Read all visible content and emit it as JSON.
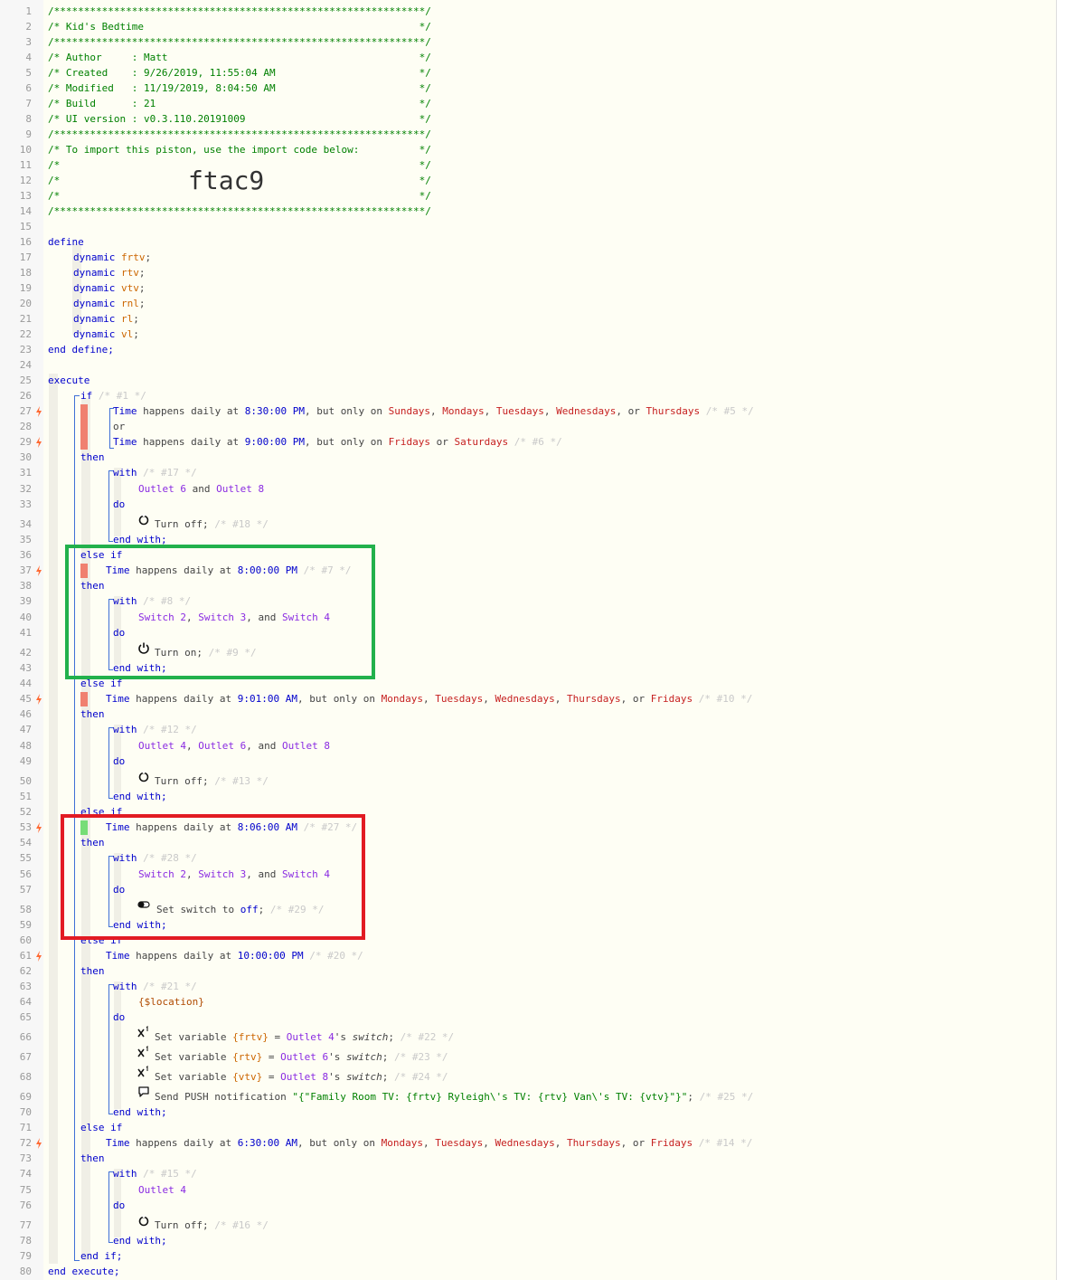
{
  "colors": {
    "keyword": "#0000cc",
    "comment": "#008000",
    "dim_comment": "#c9c9c9",
    "time": "#c62020",
    "device": "#8a2be2",
    "variable": "#cc6600",
    "bolt": "#ff6a33",
    "bar_red": "#f08070",
    "bar_green": "#77dd77",
    "frame_green": "#22b14c",
    "frame_red": "#e21b23"
  },
  "import_code": "ftac9",
  "line_numbers": [
    "1",
    "2",
    "3",
    "4",
    "5",
    "6",
    "7",
    "8",
    "9",
    "10",
    "11",
    "12",
    "13",
    "14",
    "15",
    "16",
    "17",
    "18",
    "19",
    "20",
    "21",
    "22",
    "23",
    "24",
    "25",
    "26",
    "27",
    "28",
    "29",
    "30",
    "31",
    "32",
    "33",
    "34",
    "35",
    "36",
    "37",
    "38",
    "39",
    "40",
    "41",
    "42",
    "43",
    "44",
    "45",
    "46",
    "47",
    "48",
    "49",
    "50",
    "51",
    "52",
    "53",
    "54",
    "55",
    "56",
    "57",
    "58",
    "59",
    "60",
    "61",
    "62",
    "63",
    "64",
    "65",
    "66",
    "67",
    "68",
    "69",
    "70",
    "71",
    "72",
    "73",
    "74",
    "75",
    "76",
    "77",
    "78",
    "79",
    "80"
  ],
  "lines": [
    [
      {
        "t": "/**************************************************************/",
        "c": "cm"
      }
    ],
    [
      {
        "t": "/* Kid's Bedtime                                              */",
        "c": "cm"
      }
    ],
    [
      {
        "t": "/**************************************************************/",
        "c": "cm"
      }
    ],
    [
      {
        "t": "/* Author     : Matt                                          */",
        "c": "cm"
      }
    ],
    [
      {
        "t": "/* Created    : 9/26/2019, 11:55:04 AM                        */",
        "c": "cm"
      }
    ],
    [
      {
        "t": "/* Modified   : 11/19/2019, 8:04:50 AM                        */",
        "c": "cm"
      }
    ],
    [
      {
        "t": "/* Build      : 21                                            */",
        "c": "cm"
      }
    ],
    [
      {
        "t": "/* UI version : v0.3.110.20191009                             */",
        "c": "cm"
      }
    ],
    [
      {
        "t": "/**************************************************************/",
        "c": "cm"
      }
    ],
    [
      {
        "t": "/* To import this piston, use the import code below:          */",
        "c": "cm"
      }
    ],
    [
      {
        "t": "/*                                                            */",
        "c": "cm"
      }
    ],
    [
      {
        "t": "/*                                                            */",
        "c": "cm"
      }
    ],
    [
      {
        "t": "/*                                                            */",
        "c": "cm"
      }
    ],
    [
      {
        "t": "/**************************************************************/",
        "c": "cm"
      }
    ],
    [],
    [
      {
        "t": "define",
        "c": "kw"
      }
    ],
    [
      {
        "t": "dynamic",
        "c": "kw"
      },
      {
        "t": " "
      },
      {
        "t": "frtv",
        "c": "or"
      },
      {
        "t": ";",
        "c": "dk"
      }
    ],
    [
      {
        "t": "dynamic",
        "c": "kw"
      },
      {
        "t": " "
      },
      {
        "t": "rtv",
        "c": "or"
      },
      {
        "t": ";",
        "c": "dk"
      }
    ],
    [
      {
        "t": "dynamic",
        "c": "kw"
      },
      {
        "t": " "
      },
      {
        "t": "vtv",
        "c": "or"
      },
      {
        "t": ";",
        "c": "dk"
      }
    ],
    [
      {
        "t": "dynamic",
        "c": "kw"
      },
      {
        "t": " "
      },
      {
        "t": "rnl",
        "c": "or"
      },
      {
        "t": ";",
        "c": "dk"
      }
    ],
    [
      {
        "t": "dynamic",
        "c": "kw"
      },
      {
        "t": " "
      },
      {
        "t": "rl",
        "c": "or"
      },
      {
        "t": ";",
        "c": "dk"
      }
    ],
    [
      {
        "t": "dynamic",
        "c": "kw"
      },
      {
        "t": " "
      },
      {
        "t": "vl",
        "c": "or"
      },
      {
        "t": ";",
        "c": "dk"
      }
    ],
    [
      {
        "t": "end define;",
        "c": "kw"
      }
    ],
    [],
    [
      {
        "t": "execute",
        "c": "kw"
      }
    ],
    [
      {
        "t": "if",
        "c": "kw"
      },
      {
        "t": " /* #1 */",
        "c": "cmm"
      }
    ],
    [
      {
        "t": "Time",
        "c": "kw"
      },
      {
        "t": " happens daily at ",
        "c": "dk"
      },
      {
        "t": "8:30:00 PM",
        "c": "kw"
      },
      {
        "t": ", but only on ",
        "c": "dk"
      },
      {
        "t": "Sundays",
        "c": "rd"
      },
      {
        "t": ", ",
        "c": "dk"
      },
      {
        "t": "Mondays",
        "c": "rd"
      },
      {
        "t": ", ",
        "c": "dk"
      },
      {
        "t": "Tuesdays",
        "c": "rd"
      },
      {
        "t": ", ",
        "c": "dk"
      },
      {
        "t": "Wednesdays",
        "c": "rd"
      },
      {
        "t": ", or ",
        "c": "dk"
      },
      {
        "t": "Thursdays",
        "c": "rd"
      },
      {
        "t": " /* #5 */",
        "c": "cmm"
      }
    ],
    [
      {
        "t": "or",
        "c": "dk"
      }
    ],
    [
      {
        "t": "Time",
        "c": "kw"
      },
      {
        "t": " happens daily at ",
        "c": "dk"
      },
      {
        "t": "9:00:00 PM",
        "c": "kw"
      },
      {
        "t": ", but only on ",
        "c": "dk"
      },
      {
        "t": "Fridays",
        "c": "rd"
      },
      {
        "t": " or ",
        "c": "dk"
      },
      {
        "t": "Saturdays",
        "c": "rd"
      },
      {
        "t": " /* #6 */",
        "c": "cmm"
      }
    ],
    [
      {
        "t": "then",
        "c": "kw"
      }
    ],
    [
      {
        "t": "with",
        "c": "kw"
      },
      {
        "t": " /* #17 */",
        "c": "cmm"
      }
    ],
    [
      {
        "t": "Outlet 6",
        "c": "pu"
      },
      {
        "t": " and ",
        "c": "dk"
      },
      {
        "t": "Outlet 8",
        "c": "pu"
      }
    ],
    [
      {
        "t": "do",
        "c": "kw"
      }
    ],
    [
      {
        "t": "Turn off;",
        "c": "dk"
      },
      {
        "t": " /* #18 */",
        "c": "cmm"
      }
    ],
    [
      {
        "t": "end with;",
        "c": "kw"
      }
    ],
    [
      {
        "t": "else if",
        "c": "kw"
      }
    ],
    [
      {
        "t": "Time",
        "c": "kw"
      },
      {
        "t": " happens daily at ",
        "c": "dk"
      },
      {
        "t": "8:00:00 PM",
        "c": "kw"
      },
      {
        "t": " /* #7 */",
        "c": "cmm"
      }
    ],
    [
      {
        "t": "then",
        "c": "kw"
      }
    ],
    [
      {
        "t": "with",
        "c": "kw"
      },
      {
        "t": " /* #8 */",
        "c": "cmm"
      }
    ],
    [
      {
        "t": "Switch 2",
        "c": "pu"
      },
      {
        "t": ", ",
        "c": "dk"
      },
      {
        "t": "Switch 3",
        "c": "pu"
      },
      {
        "t": ", and ",
        "c": "dk"
      },
      {
        "t": "Switch 4",
        "c": "pu"
      }
    ],
    [
      {
        "t": "do",
        "c": "kw"
      }
    ],
    [
      {
        "t": "Turn on;",
        "c": "dk"
      },
      {
        "t": " /* #9 */",
        "c": "cmm"
      }
    ],
    [
      {
        "t": "end with;",
        "c": "kw"
      }
    ],
    [
      {
        "t": "else if",
        "c": "kw"
      }
    ],
    [
      {
        "t": "Time",
        "c": "kw"
      },
      {
        "t": " happens daily at ",
        "c": "dk"
      },
      {
        "t": "9:01:00 AM",
        "c": "kw"
      },
      {
        "t": ", but only on ",
        "c": "dk"
      },
      {
        "t": "Mondays",
        "c": "rd"
      },
      {
        "t": ", ",
        "c": "dk"
      },
      {
        "t": "Tuesdays",
        "c": "rd"
      },
      {
        "t": ", ",
        "c": "dk"
      },
      {
        "t": "Wednesdays",
        "c": "rd"
      },
      {
        "t": ", ",
        "c": "dk"
      },
      {
        "t": "Thursdays",
        "c": "rd"
      },
      {
        "t": ", or ",
        "c": "dk"
      },
      {
        "t": "Fridays",
        "c": "rd"
      },
      {
        "t": " /* #10 */",
        "c": "cmm"
      }
    ],
    [
      {
        "t": "then",
        "c": "kw"
      }
    ],
    [
      {
        "t": "with",
        "c": "kw"
      },
      {
        "t": " /* #12 */",
        "c": "cmm"
      }
    ],
    [
      {
        "t": "Outlet 4",
        "c": "pu"
      },
      {
        "t": ", ",
        "c": "dk"
      },
      {
        "t": "Outlet 6",
        "c": "pu"
      },
      {
        "t": ", and ",
        "c": "dk"
      },
      {
        "t": "Outlet 8",
        "c": "pu"
      }
    ],
    [
      {
        "t": "do",
        "c": "kw"
      }
    ],
    [
      {
        "t": "Turn off;",
        "c": "dk"
      },
      {
        "t": " /* #13 */",
        "c": "cmm"
      }
    ],
    [
      {
        "t": "end with;",
        "c": "kw"
      }
    ],
    [
      {
        "t": "else if",
        "c": "kw"
      }
    ],
    [
      {
        "t": "Time",
        "c": "kw"
      },
      {
        "t": " happens daily at ",
        "c": "dk"
      },
      {
        "t": "8:06:00 AM",
        "c": "kw"
      },
      {
        "t": " /* #27 */",
        "c": "cmm"
      }
    ],
    [
      {
        "t": "then",
        "c": "kw"
      }
    ],
    [
      {
        "t": "with",
        "c": "kw"
      },
      {
        "t": " /* #28 */",
        "c": "cmm"
      }
    ],
    [
      {
        "t": "Switch 2",
        "c": "pu"
      },
      {
        "t": ", ",
        "c": "dk"
      },
      {
        "t": "Switch 3",
        "c": "pu"
      },
      {
        "t": ", and ",
        "c": "dk"
      },
      {
        "t": "Switch 4",
        "c": "pu"
      }
    ],
    [
      {
        "t": "do",
        "c": "kw"
      }
    ],
    [
      {
        "t": "Set switch to ",
        "c": "dk"
      },
      {
        "t": "off",
        "c": "kw"
      },
      {
        "t": ";",
        "c": "dk"
      },
      {
        "t": " /* #29 */",
        "c": "cmm"
      }
    ],
    [
      {
        "t": "end with;",
        "c": "kw"
      }
    ],
    [
      {
        "t": "else if",
        "c": "kw"
      }
    ],
    [
      {
        "t": "Time",
        "c": "kw"
      },
      {
        "t": " happens daily at ",
        "c": "dk"
      },
      {
        "t": "10:00:00 PM",
        "c": "kw"
      },
      {
        "t": " /* #20 */",
        "c": "cmm"
      }
    ],
    [
      {
        "t": "then",
        "c": "kw"
      }
    ],
    [
      {
        "t": "with",
        "c": "kw"
      },
      {
        "t": " /* #21 */",
        "c": "cmm"
      }
    ],
    [
      {
        "t": "{$location}",
        "c": "bw"
      }
    ],
    [
      {
        "t": "do",
        "c": "kw"
      }
    ],
    [
      {
        "t": "Set variable ",
        "c": "dk"
      },
      {
        "t": "{frtv}",
        "c": "or"
      },
      {
        "t": " = ",
        "c": "dk"
      },
      {
        "t": "Outlet 4",
        "c": "pu"
      },
      {
        "t": "'s ",
        "c": "dk"
      },
      {
        "t": "switch",
        "c": "it"
      },
      {
        "t": ";",
        "c": "dk"
      },
      {
        "t": " /* #22 */",
        "c": "cmm"
      }
    ],
    [
      {
        "t": "Set variable ",
        "c": "dk"
      },
      {
        "t": "{rtv}",
        "c": "or"
      },
      {
        "t": " = ",
        "c": "dk"
      },
      {
        "t": "Outlet 6",
        "c": "pu"
      },
      {
        "t": "'s ",
        "c": "dk"
      },
      {
        "t": "switch",
        "c": "it"
      },
      {
        "t": ";",
        "c": "dk"
      },
      {
        "t": " /* #23 */",
        "c": "cmm"
      }
    ],
    [
      {
        "t": "Set variable ",
        "c": "dk"
      },
      {
        "t": "{vtv}",
        "c": "or"
      },
      {
        "t": " = ",
        "c": "dk"
      },
      {
        "t": "Outlet 8",
        "c": "pu"
      },
      {
        "t": "'s ",
        "c": "dk"
      },
      {
        "t": "switch",
        "c": "it"
      },
      {
        "t": ";",
        "c": "dk"
      },
      {
        "t": " /* #24 */",
        "c": "cmm"
      }
    ],
    [
      {
        "t": "Send PUSH notification ",
        "c": "dk"
      },
      {
        "t": "\"{\"Family Room TV: {frtv} Ryleigh\\'s TV: {rtv} Van\\'s TV: {vtv}\"}\"",
        "c": "gn"
      },
      {
        "t": ";",
        "c": "dk"
      },
      {
        "t": " /* #25 */",
        "c": "cmm"
      }
    ],
    [
      {
        "t": "end with;",
        "c": "kw"
      }
    ],
    [
      {
        "t": "else if",
        "c": "kw"
      }
    ],
    [
      {
        "t": "Time",
        "c": "kw"
      },
      {
        "t": " happens daily at ",
        "c": "dk"
      },
      {
        "t": "6:30:00 AM",
        "c": "kw"
      },
      {
        "t": ", but only on ",
        "c": "dk"
      },
      {
        "t": "Mondays",
        "c": "rd"
      },
      {
        "t": ", ",
        "c": "dk"
      },
      {
        "t": "Tuesdays",
        "c": "rd"
      },
      {
        "t": ", ",
        "c": "dk"
      },
      {
        "t": "Wednesdays",
        "c": "rd"
      },
      {
        "t": ", ",
        "c": "dk"
      },
      {
        "t": "Thursdays",
        "c": "rd"
      },
      {
        "t": ", or ",
        "c": "dk"
      },
      {
        "t": "Fridays",
        "c": "rd"
      },
      {
        "t": " /* #14 */",
        "c": "cmm"
      }
    ],
    [
      {
        "t": "then",
        "c": "kw"
      }
    ],
    [
      {
        "t": "with",
        "c": "kw"
      },
      {
        "t": " /* #15 */",
        "c": "cmm"
      }
    ],
    [
      {
        "t": "Outlet 4",
        "c": "pu"
      }
    ],
    [
      {
        "t": "do",
        "c": "kw"
      }
    ],
    [
      {
        "t": "Turn off;",
        "c": "dk"
      },
      {
        "t": " /* #16 */",
        "c": "cmm"
      }
    ],
    [
      {
        "t": "end with;",
        "c": "kw"
      }
    ],
    [
      {
        "t": "end if;",
        "c": "kw"
      }
    ],
    [
      {
        "t": "end execute;",
        "c": "kw"
      }
    ]
  ],
  "icons": [
    {
      "name": "power-off-icon"
    },
    {
      "name": "power-on-icon"
    },
    {
      "name": "power-off-icon"
    },
    {
      "name": "toggle-switch-icon"
    },
    {
      "name": "set-variable-icon"
    },
    {
      "name": "set-variable-icon"
    },
    {
      "name": "set-variable-icon"
    },
    {
      "name": "push-notification-icon"
    },
    {
      "name": "power-off-icon"
    }
  ],
  "condition_bars": [
    {
      "color": "red"
    },
    {
      "color": "red"
    },
    {
      "color": "red"
    },
    {
      "color": "green"
    }
  ]
}
